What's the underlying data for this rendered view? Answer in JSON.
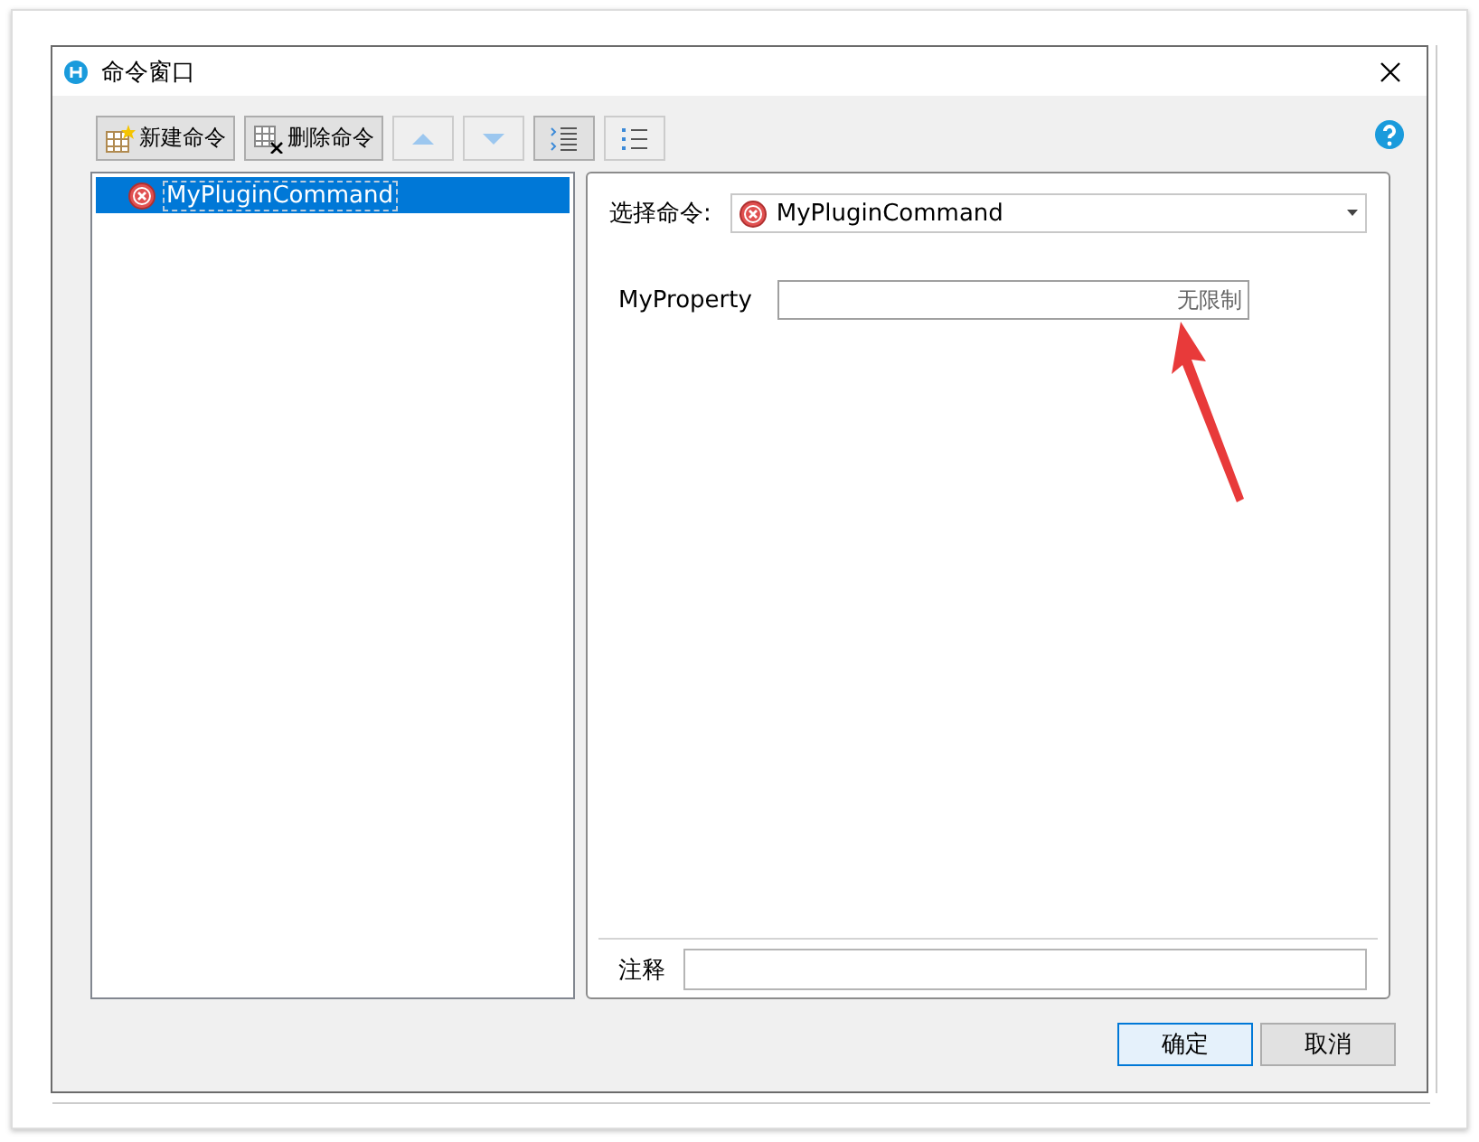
{
  "window": {
    "title": "命令窗口"
  },
  "toolbar": [
    {
      "kind": "new",
      "label": "新建命令",
      "disabled": false
    },
    {
      "kind": "delete",
      "label": "删除命令",
      "disabled": false
    },
    {
      "kind": "up",
      "disabled": true
    },
    {
      "kind": "down",
      "disabled": true
    },
    {
      "kind": "indent",
      "disabled": false
    },
    {
      "kind": "outdent",
      "disabled": true
    }
  ],
  "commands": [
    {
      "label": "MyPluginCommand",
      "selected": true
    }
  ],
  "select_command": {
    "label": "选择命令:",
    "value": "MyPluginCommand"
  },
  "properties": [
    {
      "label": "MyProperty",
      "placeholder": "无限制"
    }
  ],
  "comment": {
    "label": "注释"
  },
  "buttons": [
    {
      "label": "确定",
      "default": true
    },
    {
      "label": "取消",
      "default": false
    }
  ]
}
